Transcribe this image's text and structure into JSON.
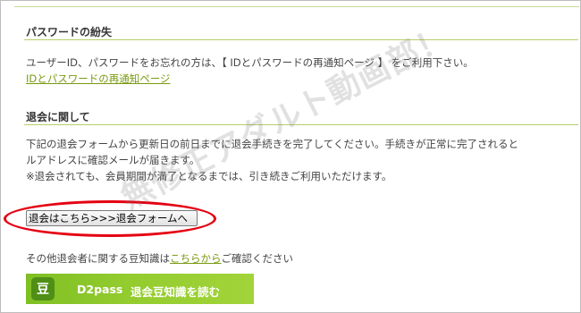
{
  "password_section": {
    "title": "パスワードの紛失",
    "text": "ユーザーID、パスワードをお忘れの方は、【 IDとパスワードの再通知ページ 】 をご利用下さい。",
    "link": "IDとパスワードの再通知ページ"
  },
  "withdraw_section": {
    "title": "退会に関して",
    "lines": [
      "下記の退会フォームから更新日の前日までに退会手続きを完了してください。手続きが正常に完了されると",
      "ルアドレスに確認メールが届きます。",
      "※退会されても、会員期間が満了となるまでは、引き続きご利用いただけます。"
    ],
    "button_label": "退会はこちら>>>退会フォームへ"
  },
  "trivia": {
    "prefix": "その他退会者に関する豆知識は",
    "link": "こちらから",
    "suffix": "ご確認ください"
  },
  "d2pass_banner": {
    "badge": "豆",
    "brand": "D2pass",
    "label": "退会豆知識を読む"
  },
  "watermark": "無修正アダルト動画部！",
  "colors": {
    "accent_green": "#7a9a12",
    "rule_green": "#b7cf6a",
    "banner_green": "#93cc2e",
    "highlight_red": "#e50012"
  }
}
